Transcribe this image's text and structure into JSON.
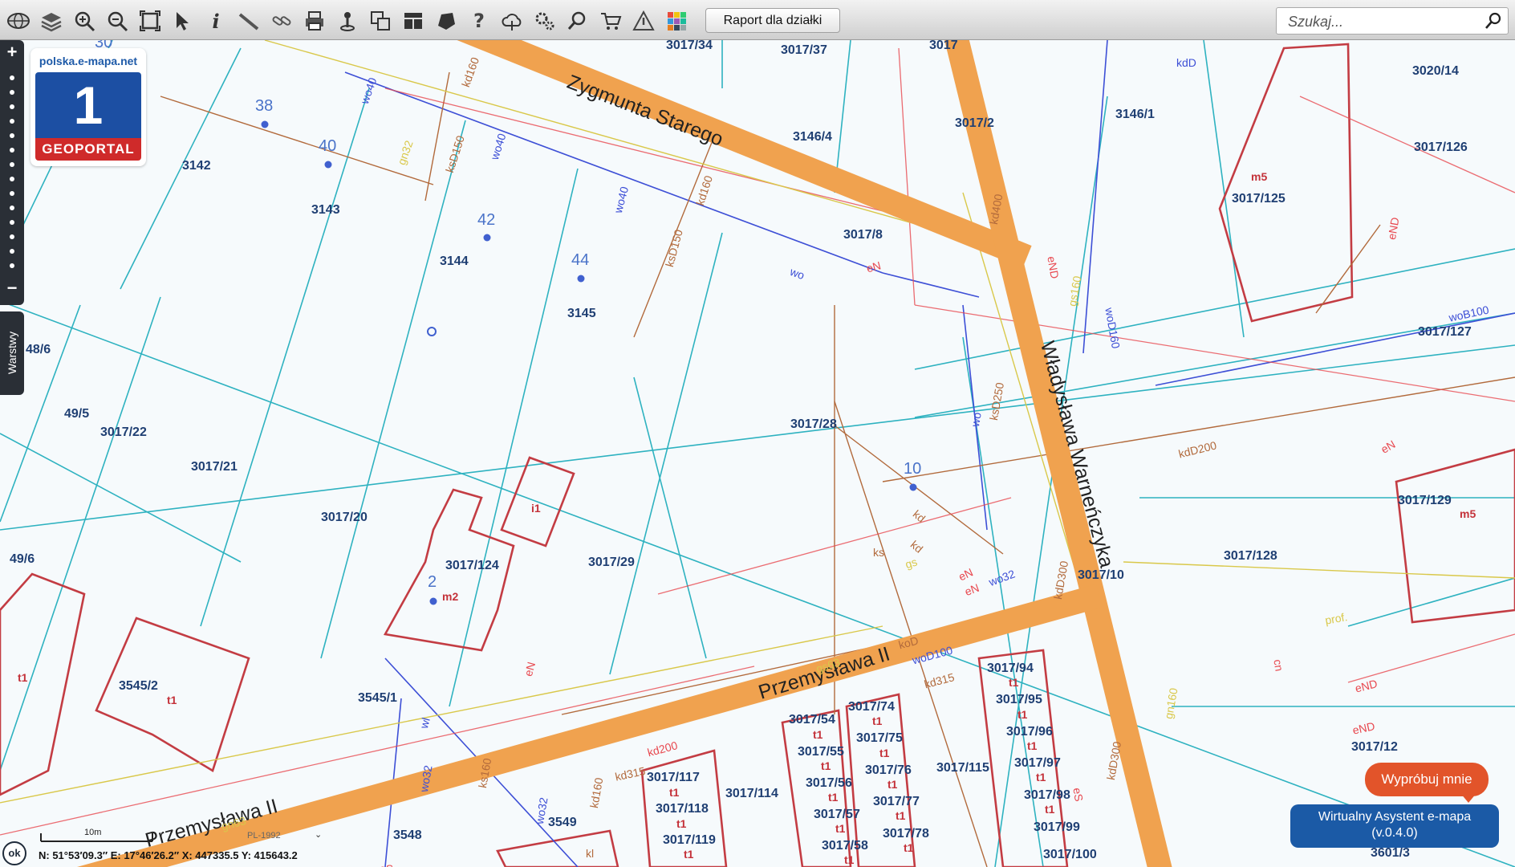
{
  "toolbar": {
    "icons": [
      "globe-icon",
      "layers-icon",
      "zoom-in-icon",
      "zoom-out-icon",
      "full-extent-icon",
      "pointer-icon",
      "info-icon",
      "measure-icon",
      "link-icon",
      "print-icon",
      "pin-icon",
      "copy-icon",
      "layout-icon",
      "shape-icon",
      "help-icon",
      "cloud-icon",
      "settings-icon",
      "find-icon",
      "cart-icon",
      "warning-icon",
      "palette-icon"
    ],
    "report_label": "Raport dla działki",
    "search_placeholder": "Szukaj..."
  },
  "logo": {
    "site": "polska.e-mapa.net",
    "number": "1",
    "name": "GEOPORTAL"
  },
  "side": {
    "layers_label": "Warstwy"
  },
  "streets": [
    "Zygmunta Starego",
    "Władysława Warneńczyka",
    "Przemysława II",
    "Przemysława II"
  ],
  "plots": [
    "3017/34",
    "3017/37",
    "3017",
    "3020/14",
    "3146/1",
    "3146/4",
    "3017/126",
    "3017/125",
    "3142",
    "3143",
    "3144",
    "3145",
    "3017/8",
    "3017/127",
    "48/6",
    "49/5",
    "3017/22",
    "3017/21",
    "3017/20",
    "3017/124",
    "3017/29",
    "3017/28",
    "3017/129",
    "3017/128",
    "49/6",
    "3545/2",
    "3545/1",
    "3017/117",
    "3017/118",
    "3017/119",
    "3017/114",
    "3017/54",
    "3017/55",
    "3017/56",
    "3017/57",
    "3017/58",
    "3017/74",
    "3017/75",
    "3017/76",
    "3017/77",
    "3017/78",
    "3017/115",
    "3017/94",
    "3017/95",
    "3017/96",
    "3017/97",
    "3017/98",
    "3017/99",
    "3017/100",
    "3017/12",
    "3548",
    "3549",
    "3601/3",
    "3017/10",
    "3017/2"
  ],
  "plot_subs": [
    "m5",
    "m5",
    "m2",
    "i1",
    "t1",
    "t1",
    "t1",
    "t1",
    "t1",
    "t1",
    "t1",
    "t1",
    "t1",
    "t1",
    "t1",
    "t1",
    "t1",
    "t1",
    "t1",
    "t1",
    "t1",
    "t1",
    "t1",
    "t1"
  ],
  "house_numbers": [
    "38",
    "40",
    "42",
    "44",
    "10",
    "2",
    "30"
  ],
  "utility_labels": [
    "kd160",
    "wo40",
    "ksD150",
    "gn32",
    "wo40",
    "kd160",
    "wo40",
    "ksD150",
    "kd400",
    "eND",
    "gs160",
    "woD160",
    "kdD",
    "woB100",
    "ksD250",
    "wo",
    "eND",
    "kdD200",
    "eN",
    "eND",
    "eN",
    "ks",
    "gs",
    "kd",
    "kdD300",
    "wo32",
    "eN",
    "gs63",
    "koD",
    "woD100",
    "kd315",
    "gn160",
    "kdD300",
    "eS",
    "eND",
    "kd315",
    "gn63",
    "wo32",
    "wo32",
    "eS",
    "kl",
    "wl",
    "prof.",
    "eN",
    "cn",
    "ks160",
    "kd200",
    "kd160",
    "eN",
    "wo",
    "kd"
  ],
  "status": {
    "coords": "N: 51°53′09.3″  E: 17°46′26.2″  X: 447335.5  Y: 415643.2",
    "scale_label": "10m",
    "crs": "PL-1992",
    "ok_label": "ok"
  },
  "assistant": {
    "try_label": "Wypróbuj mnie",
    "title": "Wirtualny Asystent e-mapa",
    "version": "(v.0.4.0)"
  },
  "colors": {
    "road": "#f0a24f",
    "parcel_line": "#2eb2c0",
    "building": "#c33c43",
    "water": "#3d4fd6",
    "sewer": "#b26a3c",
    "electric": "#e8484f",
    "gas": "#d9c84a",
    "label_blue": "#1f3f73"
  }
}
